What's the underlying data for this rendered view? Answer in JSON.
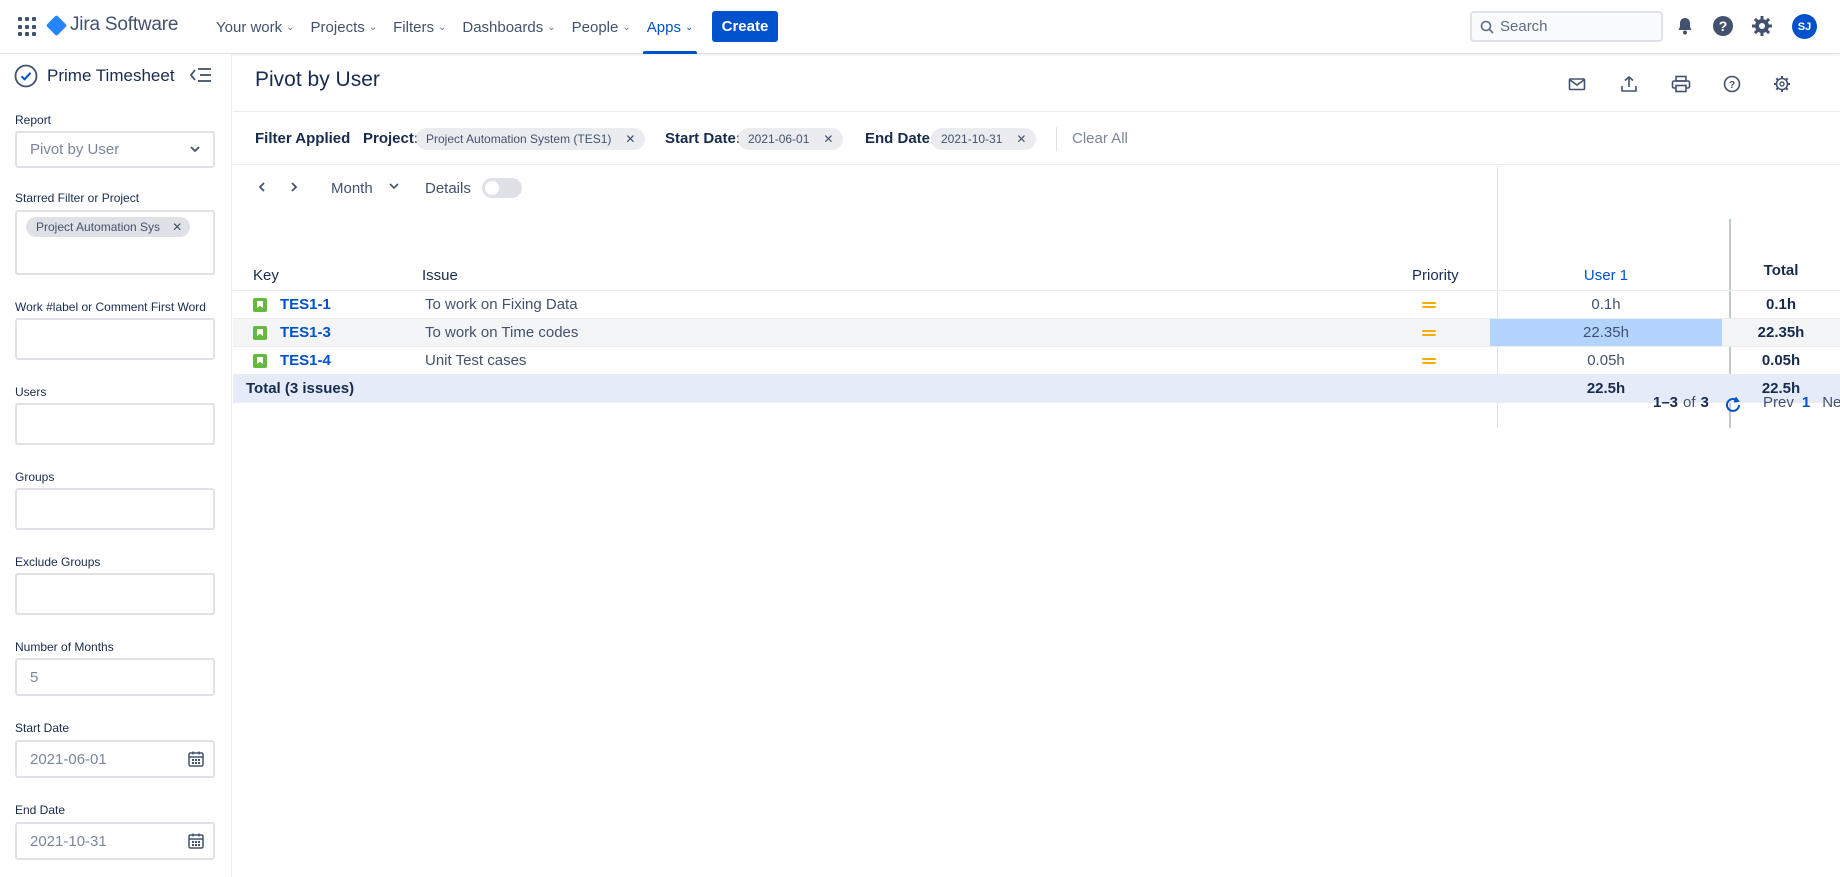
{
  "topnav": {
    "logo": "Jira Software",
    "items": [
      {
        "label": "Your work"
      },
      {
        "label": "Projects"
      },
      {
        "label": "Filters"
      },
      {
        "label": "Dashboards"
      },
      {
        "label": "People"
      },
      {
        "label": "Apps"
      }
    ],
    "active_item": "Apps",
    "create_label": "Create",
    "search_placeholder": "Search",
    "avatar_initials": "SJ"
  },
  "sidebar": {
    "title": "Prime Timesheet",
    "report_label": "Report",
    "report_value": "Pivot by User",
    "starred_label": "Starred Filter or Project",
    "starred_chip": "Project Automation Sys",
    "work_label": "Work #label or Comment First Word",
    "users_label": "Users",
    "groups_label": "Groups",
    "exclude_groups_label": "Exclude Groups",
    "months_label": "Number of Months",
    "months_value": "5",
    "start_date_label": "Start Date",
    "start_date_value": "2021-06-01",
    "end_date_label": "End Date",
    "end_date_value": "2021-10-31"
  },
  "main": {
    "title": "Pivot by User",
    "filter_bar": {
      "filter_applied": "Filter Applied",
      "project_label": "Project:",
      "project_value": "Project Automation System (TES1)",
      "start_label": "Start Date:",
      "start_value": "2021-06-01",
      "end_label": "End Date:",
      "end_value": "2021-10-31",
      "clear_all": "Clear All"
    },
    "period": {
      "unit": "Month",
      "details_label": "Details",
      "details_on": false
    },
    "table": {
      "headers": {
        "key": "Key",
        "issue": "Issue",
        "priority": "Priority",
        "user": "User 1",
        "total": "Total"
      },
      "rows": [
        {
          "key": "TES1-1",
          "issue": "To work on Fixing Data",
          "user": "0.1h",
          "total": "0.1h"
        },
        {
          "key": "TES1-3",
          "issue": "To work on Time codes",
          "user": "22.35h",
          "total": "22.35h"
        },
        {
          "key": "TES1-4",
          "issue": "Unit Test cases",
          "user": "0.05h",
          "total": "0.05h"
        }
      ],
      "total_row": {
        "label": "Total (3 issues)",
        "user": "22.5h",
        "total": "22.5h"
      }
    },
    "pager": {
      "range": "1–3",
      "of": "of",
      "count": "3",
      "prev": "Prev",
      "page": "1",
      "next": "Next"
    }
  },
  "colors": {
    "accent": "#0052CC",
    "highlight": "#B3D4FF",
    "total_row": "#E6EBFA",
    "story": "#63BA3C",
    "priority_medium": "#FFAB00"
  }
}
